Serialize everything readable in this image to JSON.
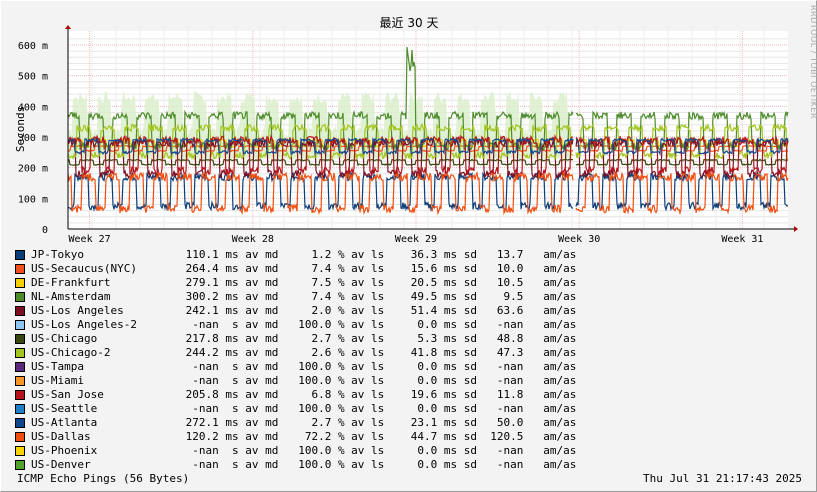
{
  "chart_data": {
    "type": "line",
    "title": "最近 30 天",
    "ylabel": "Seconds",
    "ylim_ms": [
      0,
      600
    ],
    "ytick_values_ms": [
      0,
      100,
      200,
      300,
      400,
      500,
      600
    ],
    "ytick_labels": [
      "0",
      "100 m",
      "200 m",
      "300 m",
      "400 m",
      "500 m",
      "600 m"
    ],
    "xtick_labels": [
      "Week 27",
      "Week 28",
      "Week 29",
      "Week 30",
      "Week 31"
    ],
    "grid": true,
    "range_days": 30,
    "gap_note_day_index": 21.1,
    "series": [
      {
        "name": "JP-Tokyo",
        "color": "#0b3d78",
        "median": "110.1",
        "base_ms": 75,
        "peak_ms": 170,
        "loss": "1.2"
      },
      {
        "name": "US-Secaucus(NYC)",
        "color": "#f0501d",
        "median": "264.4",
        "base_ms": 255,
        "peak_ms": 270,
        "loss": "7.4"
      },
      {
        "name": "DE-Frankfurt",
        "color": "#f5cf00",
        "median": "279.1",
        "base_ms": 270,
        "peak_ms": 290,
        "loss": "7.5"
      },
      {
        "name": "NL-Amsterdam",
        "color": "#4d8c2b",
        "median": "300.2",
        "base_ms": 270,
        "peak_ms": 370,
        "loss": "7.4"
      },
      {
        "name": "US-Los Angeles",
        "color": "#7a0f23",
        "median": "242.1",
        "base_ms": 180,
        "peak_ms": 280,
        "loss": "2.0"
      },
      {
        "name": "US-Los Angeles-2",
        "color": "#8ec4f0",
        "median": "-nan",
        "loss": "100.0"
      },
      {
        "name": "US-Chicago",
        "color": "#38470f",
        "median": "217.8",
        "base_ms": 210,
        "peak_ms": 225,
        "loss": "2.7"
      },
      {
        "name": "US-Chicago-2",
        "color": "#a3c51f",
        "median": "244.2",
        "base_ms": 240,
        "peak_ms": 330,
        "loss": "2.6"
      },
      {
        "name": "US-Tampa",
        "color": "#5a2a7a",
        "median": "-nan",
        "loss": "100.0"
      },
      {
        "name": "US-Miami",
        "color": "#f6952a",
        "median": "-nan",
        "loss": "100.0"
      },
      {
        "name": "US-San Jose",
        "color": "#b5121b",
        "median": "205.8",
        "base_ms": 190,
        "peak_ms": 290,
        "loss": "6.8"
      },
      {
        "name": "US-Seattle",
        "color": "#1f7fc5",
        "median": "-nan",
        "loss": "100.0"
      },
      {
        "name": "US-Atlanta",
        "color": "#13478c",
        "median": "272.1",
        "base_ms": 250,
        "peak_ms": 290,
        "loss": "2.7"
      },
      {
        "name": "US-Dallas",
        "color": "#f04e0f",
        "median": "120.2",
        "base_ms": 65,
        "peak_ms": 170,
        "loss": "72.2"
      },
      {
        "name": "US-Phoenix",
        "color": "#f8d400",
        "median": "-nan",
        "loss": "100.0"
      },
      {
        "name": "US-Denver",
        "color": "#52a32b",
        "median": "-nan",
        "loss": "100.0"
      }
    ]
  },
  "legend": [
    {
      "name": "JP-Tokyo",
      "color": "#0b3d78",
      "stats": " 110.1 ms av md     1.2 % av ls    36.3 ms sd   13.7   am/as"
    },
    {
      "name": "US-Secaucus(NYC)",
      "color": "#f0501d",
      "stats": " 264.4 ms av md     7.4 % av ls    15.6 ms sd   10.0   am/as"
    },
    {
      "name": "DE-Frankfurt",
      "color": "#f5cf00",
      "stats": " 279.1 ms av md     7.5 % av ls    20.5 ms sd   10.5   am/as"
    },
    {
      "name": "NL-Amsterdam",
      "color": "#4d8c2b",
      "stats": " 300.2 ms av md     7.4 % av ls    49.5 ms sd    9.5   am/as"
    },
    {
      "name": "US-Los Angeles",
      "color": "#7a0f23",
      "stats": " 242.1 ms av md     2.0 % av ls    51.4 ms sd   63.6   am/as"
    },
    {
      "name": "US-Los Angeles-2",
      "color": "#8ec4f0",
      "stats": "  -nan  s av md   100.0 % av ls     0.0 ms sd   -nan   am/as"
    },
    {
      "name": "US-Chicago",
      "color": "#38470f",
      "stats": " 217.8 ms av md     2.7 % av ls     5.3 ms sd   48.8   am/as"
    },
    {
      "name": "US-Chicago-2",
      "color": "#a3c51f",
      "stats": " 244.2 ms av md     2.6 % av ls    41.8 ms sd   47.3   am/as"
    },
    {
      "name": "US-Tampa",
      "color": "#5a2a7a",
      "stats": "  -nan  s av md   100.0 % av ls     0.0 ms sd   -nan   am/as"
    },
    {
      "name": "US-Miami",
      "color": "#f6952a",
      "stats": "  -nan  s av md   100.0 % av ls     0.0 ms sd   -nan   am/as"
    },
    {
      "name": "US-San Jose",
      "color": "#b5121b",
      "stats": " 205.8 ms av md     6.8 % av ls    19.6 ms sd   11.8   am/as"
    },
    {
      "name": "US-Seattle",
      "color": "#1f7fc5",
      "stats": "  -nan  s av md   100.0 % av ls     0.0 ms sd   -nan   am/as"
    },
    {
      "name": "US-Atlanta",
      "color": "#13478c",
      "stats": " 272.1 ms av md     2.7 % av ls    23.1 ms sd   50.0   am/as"
    },
    {
      "name": "US-Dallas",
      "color": "#f04e0f",
      "stats": " 120.2 ms av md    72.2 % av ls    44.7 ms sd  120.5   am/as"
    },
    {
      "name": "US-Phoenix",
      "color": "#f8d400",
      "stats": "  -nan  s av md   100.0 % av ls     0.0 ms sd   -nan   am/as"
    },
    {
      "name": "US-Denver",
      "color": "#52a32b",
      "stats": "  -nan  s av md   100.0 % av ls     0.0 ms sd   -nan   am/as"
    }
  ],
  "footer": {
    "left": "ICMP Echo Pings (56 Bytes)",
    "right": "Thu Jul 31 21:17:43 2025"
  },
  "credit": "RRDTOOL / TOBI OETIKER"
}
